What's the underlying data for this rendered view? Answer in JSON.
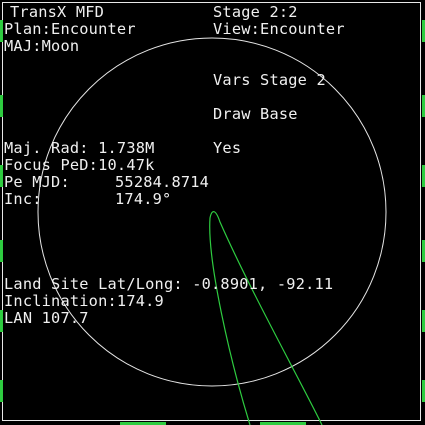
{
  "mfd": {
    "title": "TransX MFD",
    "stage": "Stage 2:2",
    "plan": "Plan:Encounter",
    "view": "View:Encounter",
    "major_body": "MAJ:Moon",
    "vars_heading": "Vars Stage 2",
    "selected_var_label": "Draw Base",
    "selected_var_value": "Yes",
    "maj_rad": "Maj. Rad: 1.738M",
    "focus_ped": "Focus PeD:10.47k",
    "pe_mjd_label": "Pe MJD:",
    "pe_mjd_value": "55284.8714",
    "inc_label": "Inc:",
    "inc_value": "174.9°",
    "land_site": "Land Site Lat/Long: -0.8901, -92.11",
    "inclination": "Inclination:174.9",
    "lan": "LAN 107.7"
  },
  "colors": {
    "background": "#000000",
    "text": "#f0f0f0",
    "planet_circle": "#e6e6e6",
    "trajectory": "#2ecc40",
    "frame": "#e8e8e8"
  }
}
